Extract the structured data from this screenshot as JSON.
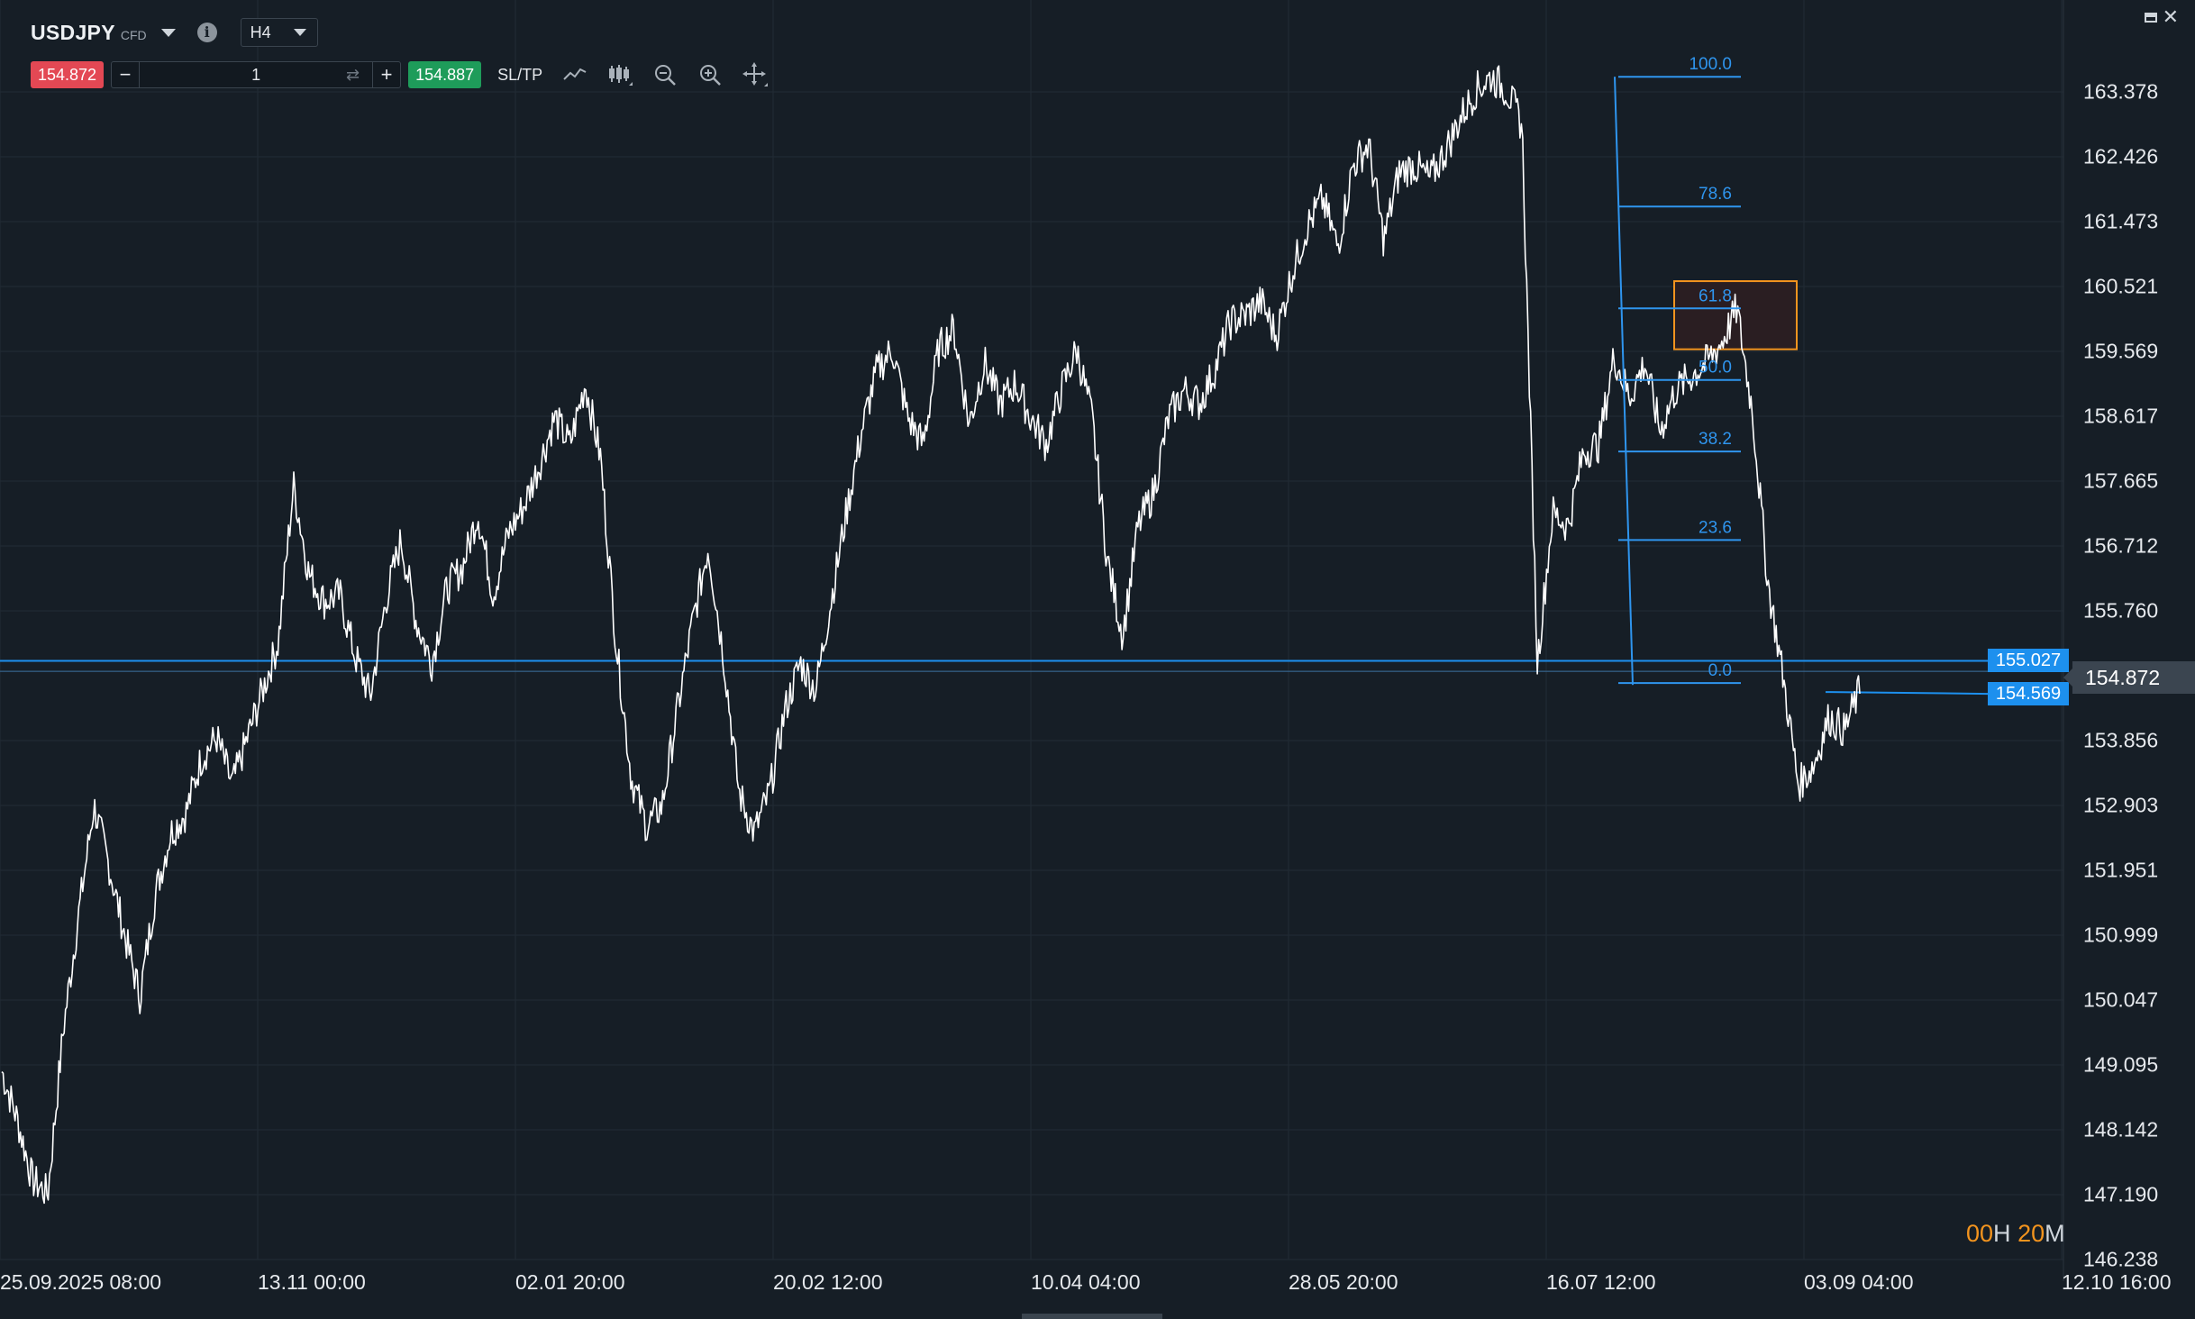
{
  "header": {
    "symbol": "USDJPY",
    "symbol_type": "CFD",
    "info_icon": "i",
    "timeframe": "H4"
  },
  "trade_bar": {
    "sell_price": "154.872",
    "buy_price": "154.887",
    "quantity": "1",
    "minus_label": "−",
    "plus_label": "+",
    "sltp_label": "SL/TP",
    "icons": [
      "line-chart-icon",
      "candles-icon",
      "zoom-out-icon",
      "zoom-in-icon",
      "crosshair-icon"
    ]
  },
  "window_controls": {
    "icons": [
      "minimize-icon",
      "close-icon"
    ],
    "close_label": "✕"
  },
  "price_axis": {
    "labels": [
      "163.378",
      "162.426",
      "161.473",
      "160.521",
      "159.569",
      "158.617",
      "157.665",
      "156.712",
      "155.760",
      "153.856",
      "152.903",
      "151.951",
      "150.999",
      "150.047",
      "149.095",
      "148.142",
      "147.190",
      "146.238"
    ],
    "current_price": "154.872",
    "line_tag_upper": "155.027",
    "line_tag_lower": "154.569"
  },
  "time_axis": {
    "labels": [
      "25.09.2025 08:00",
      "13.11 00:00",
      "02.01 20:00",
      "20.02 12:00",
      "10.04 04:00",
      "28.05 20:00",
      "16.07 12:00",
      "03.09 04:00",
      "12.10 16:00"
    ]
  },
  "countdown": {
    "hours": "00",
    "hours_unit": "H",
    "minutes": "20",
    "minutes_unit": "M"
  },
  "chart_data": {
    "type": "line",
    "symbol": "USDJPY",
    "timeframe": "H4",
    "ylim": [
      146.238,
      163.378
    ],
    "y_ticks": [
      163.378,
      162.426,
      161.473,
      160.521,
      159.569,
      158.617,
      157.665,
      156.712,
      155.76,
      154.872,
      153.856,
      152.903,
      151.951,
      150.999,
      150.047,
      149.095,
      148.142,
      147.19,
      146.238
    ],
    "x_ticks": [
      "25.09.2025 08:00",
      "13.11 00:00",
      "02.01 20:00",
      "20.02 12:00",
      "10.04 04:00",
      "28.05 20:00",
      "16.07 12:00",
      "03.09 04:00",
      "12.10 16:00"
    ],
    "grid": true,
    "series": [
      {
        "color": "#ffffff",
        "values": [
          149.0,
          148.3,
          147.4,
          147.2,
          149.6,
          151.3,
          152.9,
          152.0,
          151.0,
          150.1,
          151.6,
          152.5,
          152.8,
          153.6,
          153.9,
          153.2,
          153.9,
          154.6,
          155.3,
          157.6,
          156.3,
          155.9,
          156.0,
          155.1,
          154.5,
          155.9,
          156.8,
          155.6,
          155.0,
          156.1,
          156.4,
          157.2,
          156.0,
          156.9,
          157.3,
          157.9,
          158.6,
          158.2,
          159.1,
          158.0,
          155.3,
          153.3,
          152.6,
          152.9,
          154.3,
          155.6,
          156.7,
          155.1,
          153.1,
          152.5,
          153.1,
          154.3,
          155.0,
          154.6,
          155.9,
          157.2,
          158.4,
          159.3,
          159.6,
          158.6,
          158.2,
          159.6,
          159.9,
          158.5,
          159.4,
          158.8,
          159.1,
          158.6,
          158.2,
          159.0,
          159.6,
          158.6,
          156.5,
          155.4,
          157.0,
          157.5,
          158.6,
          159.0,
          158.8,
          159.3,
          160.0,
          160.1,
          160.3,
          159.8,
          160.7,
          161.4,
          161.8,
          161.1,
          162.3,
          162.6,
          161.2,
          162.2,
          162.3,
          162.1,
          162.5,
          163.0,
          163.4,
          163.6,
          163.4,
          162.9,
          155.0,
          157.2,
          157.0,
          158.1,
          158.2,
          159.5,
          158.9,
          159.4,
          158.4,
          159.0,
          159.2,
          159.4,
          159.7,
          160.2,
          158.7,
          156.2,
          154.8,
          153.2,
          153.5,
          154.2,
          154.0,
          154.6
        ]
      }
    ],
    "horizontal_lines": [
      155.027,
      154.569
    ],
    "fibonacci": {
      "high": 163.6,
      "low": 154.7,
      "levels": [
        "100.0",
        "78.6",
        "61.8",
        "50.0",
        "38.2",
        "23.6",
        "0.0"
      ],
      "level_values": [
        1.0,
        0.786,
        0.618,
        0.5,
        0.382,
        0.236,
        0.0
      ],
      "color": "#2f95ee"
    },
    "rectangle": {
      "y_range": [
        159.6,
        160.6
      ],
      "border_color": "#f3941e",
      "fill_color": "#2a1e22"
    },
    "colors": {
      "background": "#161e26",
      "grid": "#222c35",
      "sell": "#e34854",
      "buy": "#1e9c5a",
      "accent": "#1d90ee",
      "countdown": "#f3941e"
    }
  }
}
